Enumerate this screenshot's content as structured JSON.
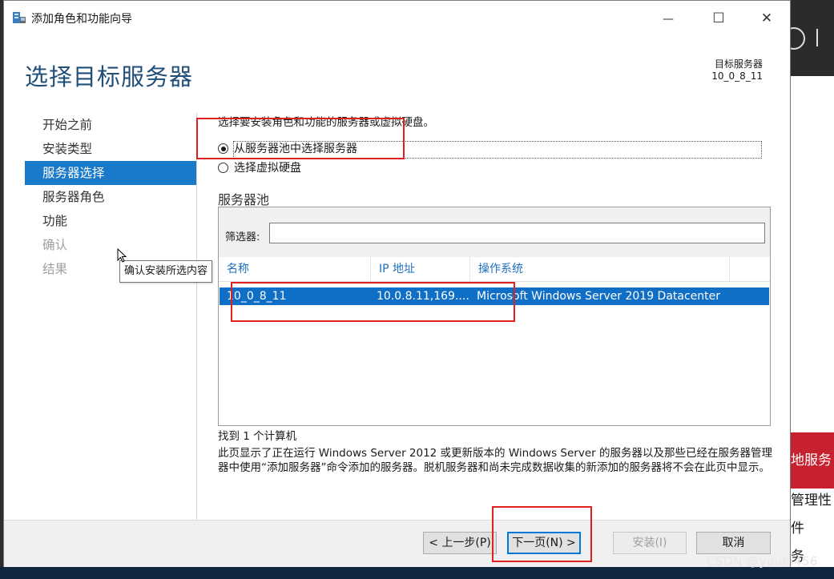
{
  "window": {
    "title": "添加角色和功能向导",
    "controls": {
      "minimize": "—",
      "maximize": "☐",
      "close": "✕"
    }
  },
  "header": {
    "page_title": "选择目标服务器",
    "destination_label": "目标服务器",
    "destination_value": "10_0_8_11"
  },
  "nav": {
    "items": [
      {
        "label": "开始之前",
        "state": "normal"
      },
      {
        "label": "安装类型",
        "state": "normal"
      },
      {
        "label": "服务器选择",
        "state": "active"
      },
      {
        "label": "服务器角色",
        "state": "normal"
      },
      {
        "label": "功能",
        "state": "normal"
      },
      {
        "label": "确认",
        "state": "disabled"
      },
      {
        "label": "结果",
        "state": "disabled"
      }
    ]
  },
  "tooltip": {
    "text": "确认安装所选内容"
  },
  "content": {
    "intro": "选择要安装角色和功能的服务器或虚拟硬盘。",
    "radio_pool": {
      "label": "从服务器池中选择服务器",
      "checked": true
    },
    "radio_vhd": {
      "label": "选择虚拟硬盘",
      "checked": false
    },
    "pool_heading": "服务器池",
    "filter": {
      "label": "筛选器:",
      "value": ""
    },
    "columns": [
      "名称",
      "IP 地址",
      "操作系统"
    ],
    "rows": [
      {
        "name": "10_0_8_11",
        "ip": "10.0.8.11,169....",
        "os": "Microsoft Windows Server 2019 Datacenter"
      }
    ],
    "found": "找到 1 个计算机",
    "description": "此页显示了正在运行 Windows Server 2012 或更新版本的 Windows Server 的服务器以及那些已经在服务器管理器中使用“添加服务器”命令添加的服务器。脱机服务器和尚未完成数据收集的新添加的服务器将不会在此页中显示。"
  },
  "footer": {
    "prev": "< 上一步(P)",
    "next": "下一页(N) >",
    "install": "安装(I)",
    "cancel": "取消"
  },
  "background_app": {
    "red_banner": "地服务",
    "line1": "管理性",
    "line2": "件",
    "line3": "务"
  },
  "watermark": "CSDN @yuuki456",
  "colors": {
    "accent": "#1979ca",
    "title": "#1f4e79",
    "selection": "#0f6fc6",
    "annotation": "#e0201f"
  }
}
